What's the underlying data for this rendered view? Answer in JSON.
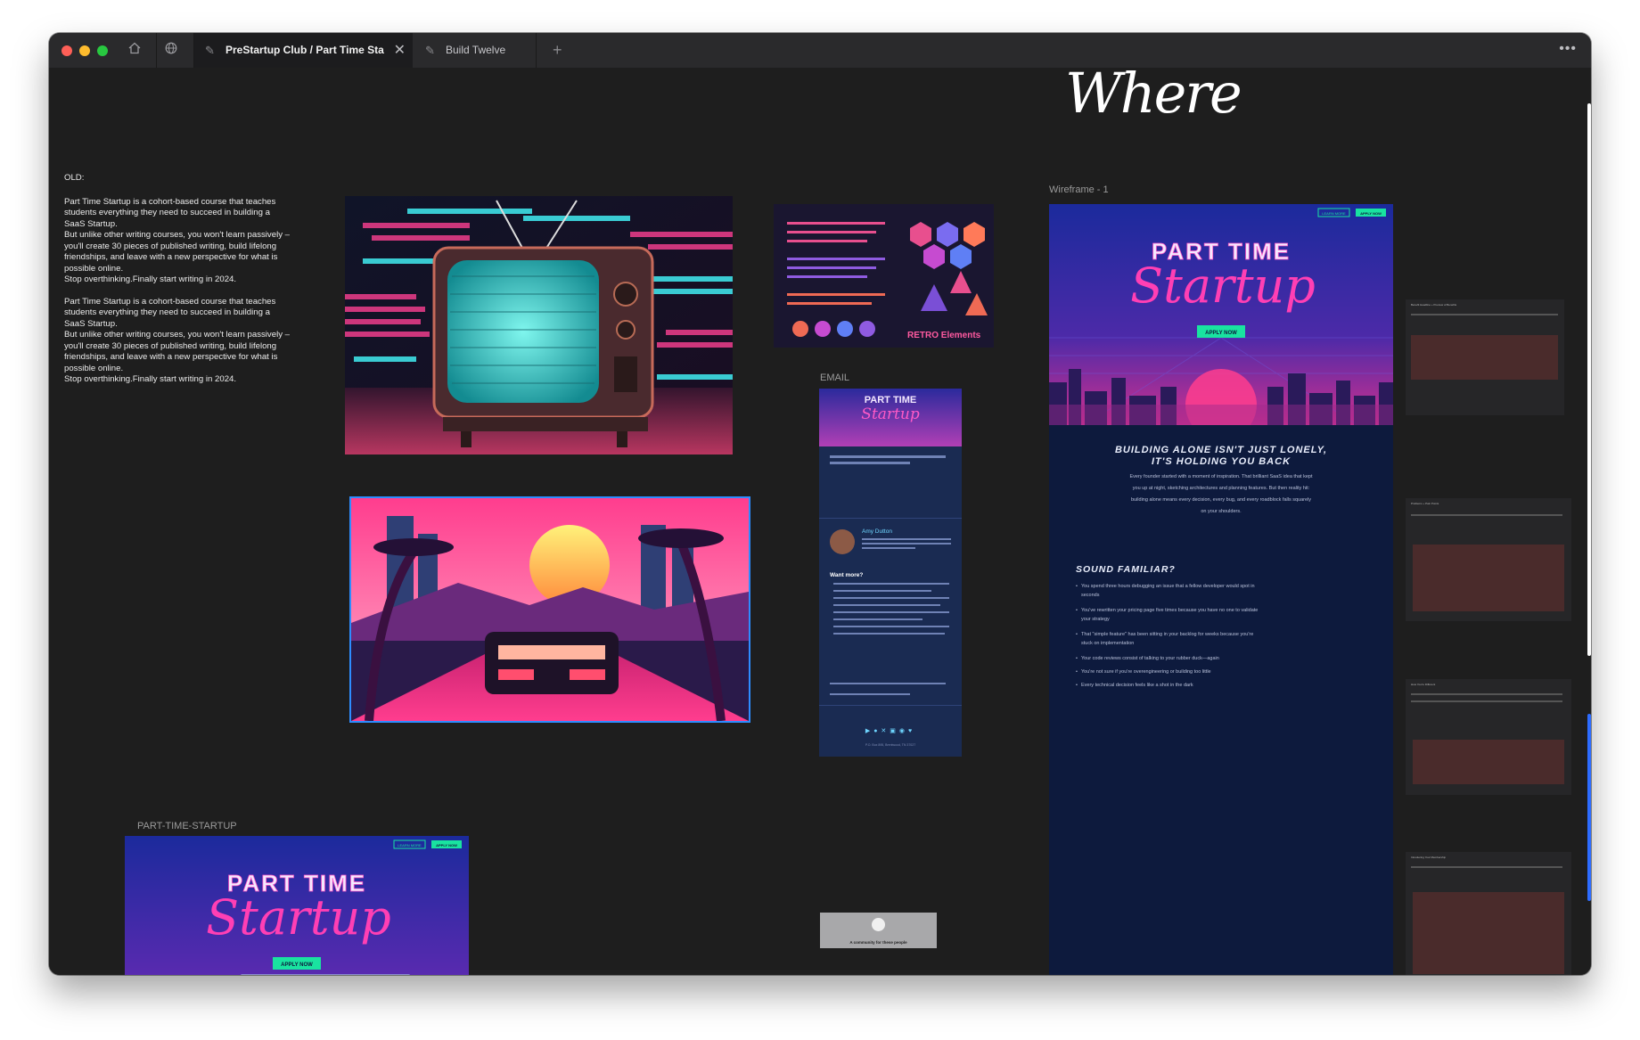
{
  "browser": {
    "tabs": [
      {
        "label": "PreStartup Club / Part Time Start",
        "active": true
      },
      {
        "label": "Build Twelve",
        "active": false
      }
    ]
  },
  "canvas": {
    "heading_fragment": "Where",
    "notes": {
      "label": "OLD:",
      "paragraph_1": [
        "Part Time Startup is a cohort-based course that teaches students everything they need to succeed in building a SaaS Startup.",
        "But unlike other writing courses, you won't learn passively – you'll create 30 pieces of published writing, build lifelong friendships, and leave with a new perspective for what is possible online.",
        "Stop overthinking.Finally start writing in 2024."
      ],
      "paragraph_2": [
        "Part Time Startup is a cohort-based course that teaches students everything they need to succeed in building a SaaS Startup.",
        "But unlike other writing courses, you won't learn passively – you'll create 30 pieces of published writing, build lifelong friendships, and leave with a new perspective for what is possible online.",
        "Stop overthinking.Finally start writing in 2024."
      ]
    },
    "frame_labels": {
      "email": "EMAIL",
      "wireframe": "Wireframe - 1",
      "part_time_startup": "PART-TIME-STARTUP"
    },
    "retro_elements_caption": "RETRO Elements",
    "hero": {
      "title_top": "PART TIME",
      "title_script": "Startup",
      "cta": "APPLY NOW",
      "nav_learn": "LEARN MORE",
      "nav_apply": "APPLY NOW"
    },
    "email": {
      "author": "Amy Dutton",
      "want_more": "Want more?",
      "footer_address": "P.O. Box 895, Brentwood, TN 37027"
    },
    "wireframe": {
      "headline_1": "BUILDING ALONE ISN'T JUST LONELY,",
      "headline_2": "IT'S HOLDING YOU BACK",
      "body": "Every founder started with a moment of inspiration. That brilliant SaaS idea that kept you up at night, sketching architectures and planning features. But then reality hit: building alone means every decision, every bug, and every roadblock falls squarely on your shoulders.",
      "sound_familiar": "SOUND FAMILIAR?",
      "bullets": [
        "You spend three hours debugging an issue that a fellow developer would spot in seconds",
        "You've rewritten your pricing page five times because you have no one to validate your strategy",
        "That \"simple feature\" has been sitting in your backlog for weeks because you're stuck on implementation",
        "Your code reviews consist of talking to your rubber duck—again",
        "You're not sure if you're overengineering or building too little",
        "Every technical decision feels like a shot in the dark"
      ]
    },
    "side_notes": [
      {
        "title": "Benefit Headline + Preview of Benefits"
      },
      {
        "title": "Problems + Pain Points"
      },
      {
        "title": "How You're Different"
      },
      {
        "title": "Introducing Your Membership"
      }
    ],
    "thumb_caption": "A community for these people"
  }
}
